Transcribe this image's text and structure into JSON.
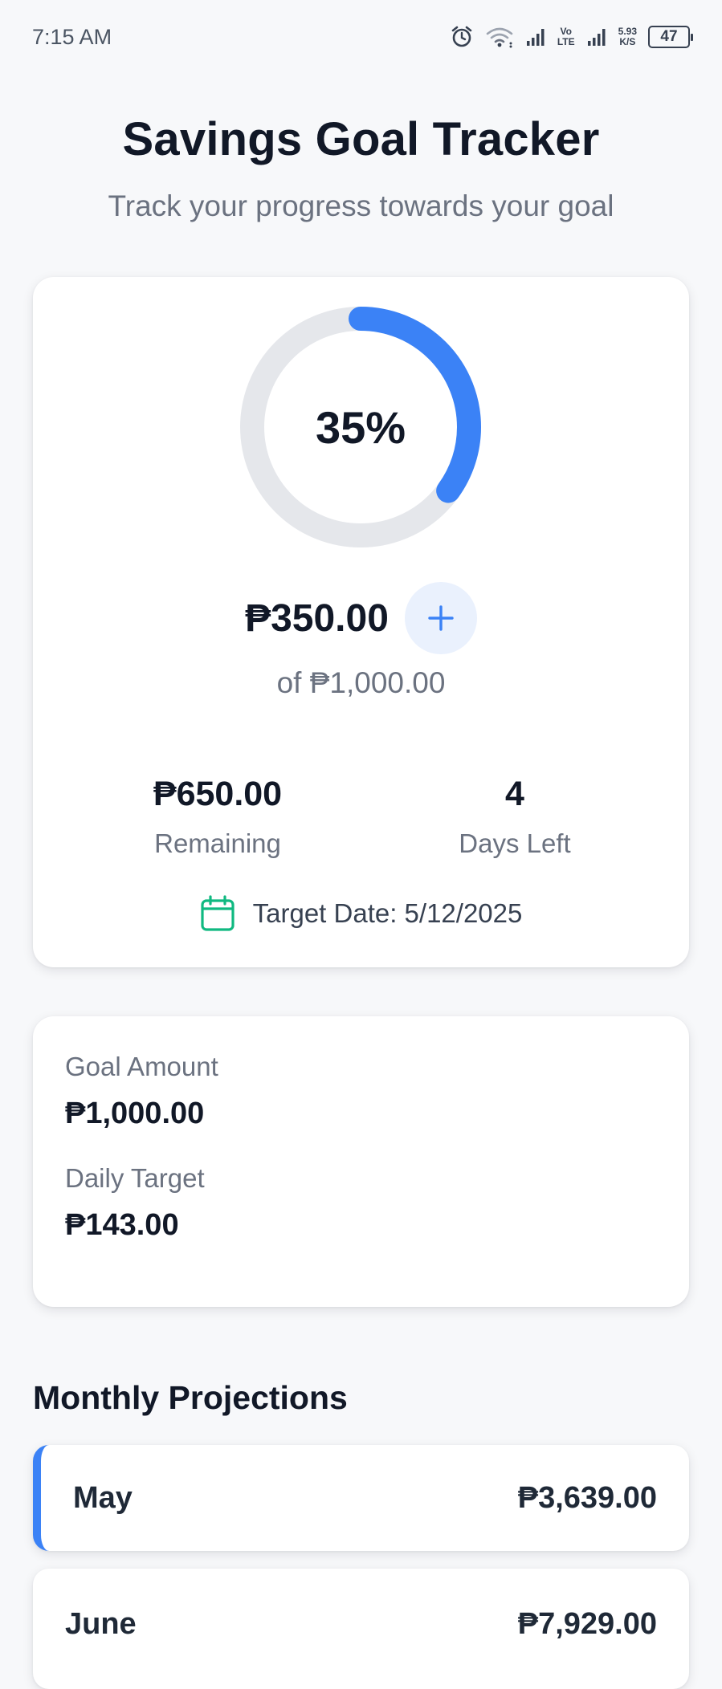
{
  "status_bar": {
    "time": "7:15 AM",
    "volte_top": "Vo",
    "volte_bottom": "LTE",
    "speed_value": "5.93",
    "speed_unit": "K/S",
    "battery": "47",
    "icons": [
      "alarm-icon",
      "wifi-icon",
      "signal-icon",
      "signal-icon"
    ]
  },
  "header": {
    "title": "Savings Goal Tracker",
    "subtitle": "Track your progress towards your goal"
  },
  "progress": {
    "percent_label": "35%",
    "percent_value": 0.35,
    "ring_color": "#3b82f6",
    "track_color": "#e5e7eb",
    "saved": "₱350.00",
    "goal_line": "of ₱1,000.00",
    "remaining_value": "₱650.00",
    "remaining_label": "Remaining",
    "days_value": "4",
    "days_label": "Days Left",
    "target_date": "Target Date: 5/12/2025",
    "calendar_color": "#10b981"
  },
  "goal_info": {
    "goal_label": "Goal Amount",
    "goal_value": "₱1,000.00",
    "daily_label": "Daily Target",
    "daily_value": "₱143.00"
  },
  "projections": {
    "title": "Monthly Projections",
    "items": [
      {
        "month": "May",
        "amount": "₱3,639.00"
      },
      {
        "month": "June",
        "amount": "₱7,929.00"
      }
    ]
  }
}
